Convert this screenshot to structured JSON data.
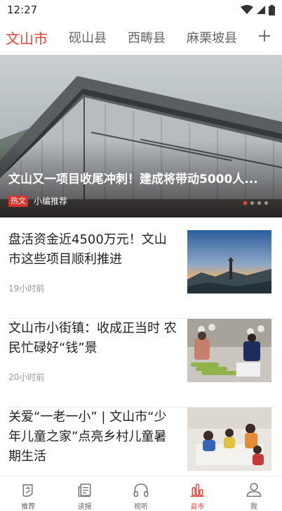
{
  "status": {
    "time": "12:27"
  },
  "tabs": [
    {
      "label": "文山市",
      "active": true
    },
    {
      "label": "砚山县",
      "active": false
    },
    {
      "label": "西畴县",
      "active": false
    },
    {
      "label": "麻栗坡县",
      "active": false
    }
  ],
  "tab_add_icon": "plus-icon",
  "hero": {
    "title": "文山又一项目收尾冲刺！建成将带动5000人...",
    "badge": "热文",
    "source": "小编推荐",
    "slide_count": 4,
    "active_slide": 1
  },
  "articles": [
    {
      "title": "盘活资金近4500万元！文山市这些项目顺利推进",
      "time": "19小时前"
    },
    {
      "title": "文山市小街镇：收成正当时 农民忙碌好“钱”景",
      "time": "20小时前"
    },
    {
      "title": "关爱“一老一小” | 文山市“少年儿童之家”点亮乡村儿童暑期生活",
      "time": ""
    }
  ],
  "bottom_nav": [
    {
      "label": "推荐",
      "icon": "recommend-icon",
      "active": false
    },
    {
      "label": "读报",
      "icon": "newspaper-icon",
      "active": false
    },
    {
      "label": "视听",
      "icon": "headphones-icon",
      "active": false
    },
    {
      "label": "县市",
      "icon": "county-chart-icon",
      "active": true
    },
    {
      "label": "我",
      "icon": "profile-icon",
      "active": false
    }
  ],
  "colors": {
    "accent": "#e8443a",
    "badge": "#d9342b"
  }
}
